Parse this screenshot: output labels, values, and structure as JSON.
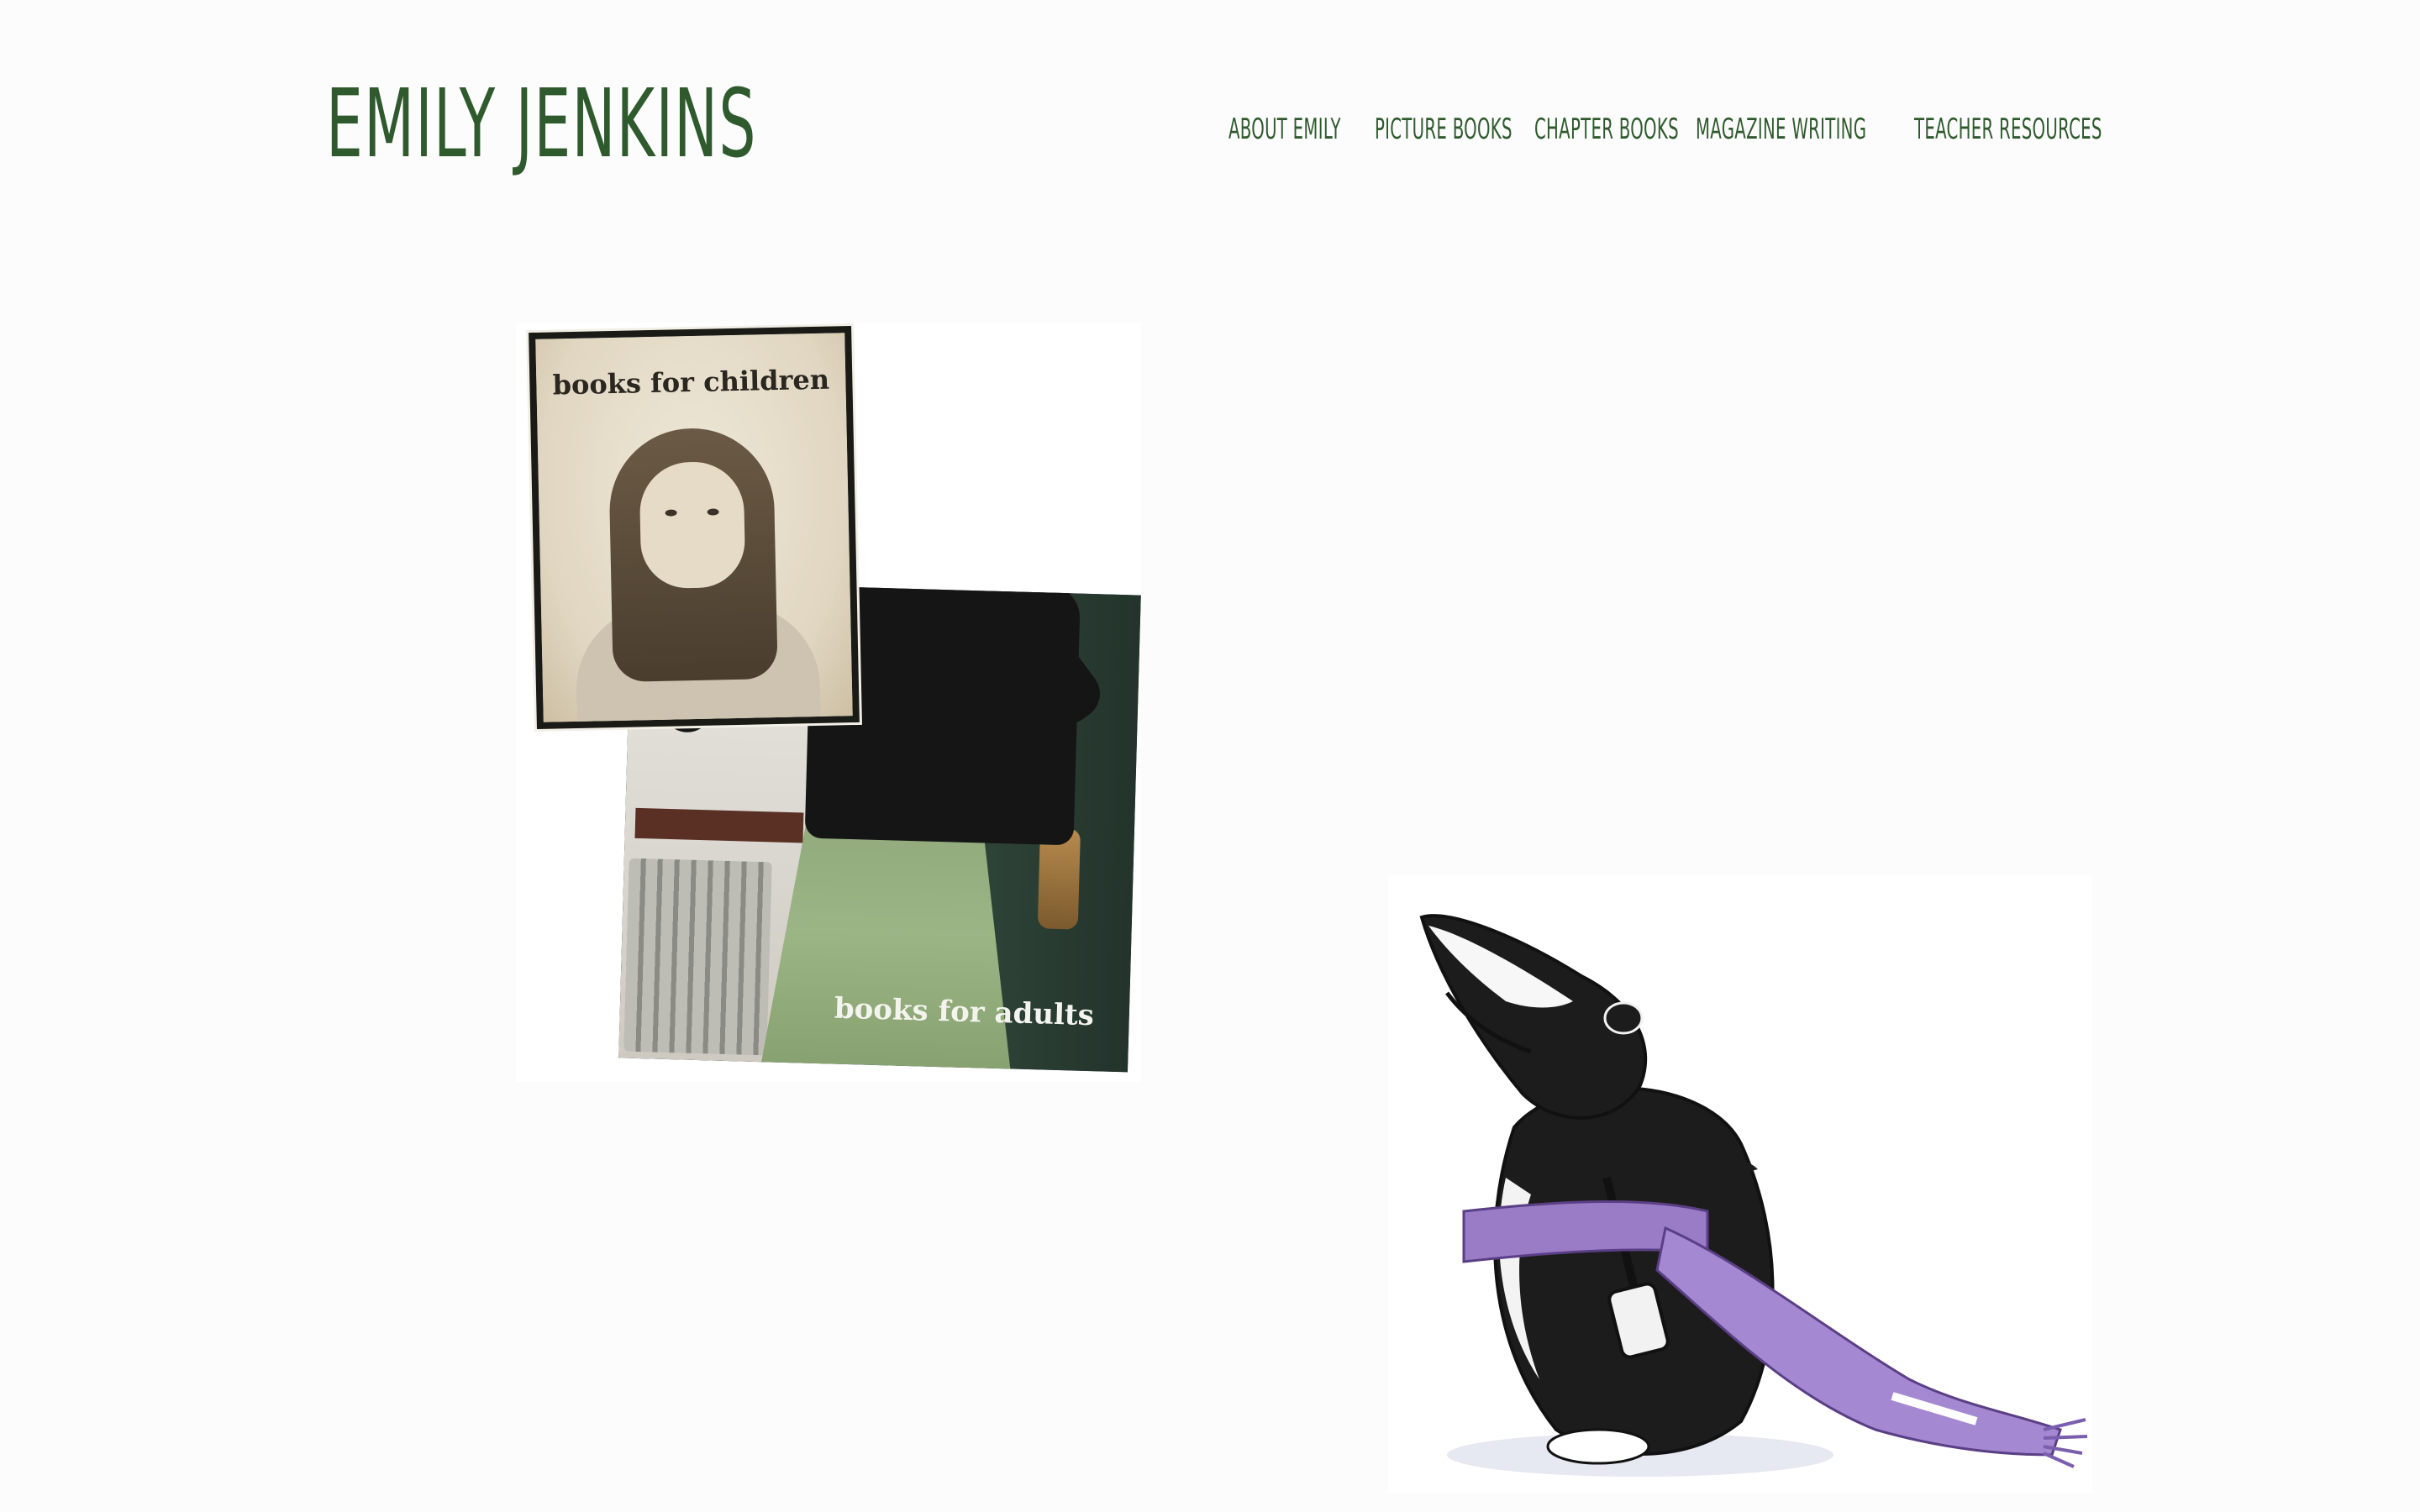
{
  "header": {
    "site_title": "EMILY JENKINS",
    "nav": [
      {
        "label": "ABOUT EMILY"
      },
      {
        "label": "PICTURE BOOKS"
      },
      {
        "label": "CHAPTER BOOKS"
      },
      {
        "label": "MAGAZINE WRITING"
      },
      {
        "label": "TEACHER RESOURCES"
      }
    ]
  },
  "main": {
    "collage": {
      "children_label": "books for children",
      "adults_label": "books for adults"
    }
  },
  "colors": {
    "title_green": "#2f5a2e",
    "background": "#fcfcfc",
    "scarf_purple": "#9a7bc6"
  }
}
